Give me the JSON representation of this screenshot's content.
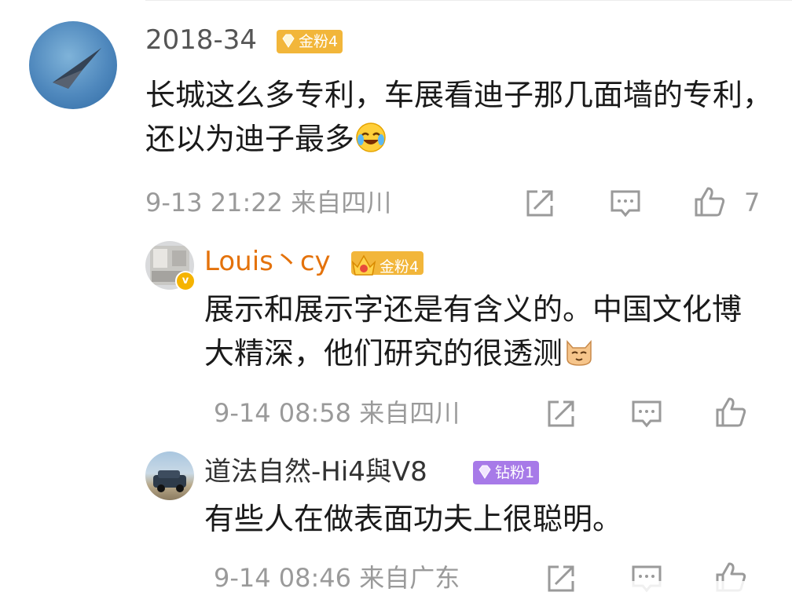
{
  "comment": {
    "username": "2018-34",
    "badge": "金粉4",
    "badge_color": "#f2b63a",
    "text": "长城这么多专利，车展看迪子那几面墙的专利，还以为迪子最多",
    "emoji": "laugh-cry-emoji",
    "meta": "9-13 21:22 来自四川",
    "like_count": "7"
  },
  "replies": [
    {
      "username": "Louis丶cy",
      "username_color": "#e4720b",
      "badge": "金粉4",
      "badge_color": "#f2b63a",
      "verified": "v",
      "text": "展示和展示字还是有含义的。中国文化博大精深，他们研究的很透测",
      "emoji": "cat-emoji",
      "meta": "9-14 08:58 来自四川"
    },
    {
      "username": "道法自然-Hi4與V8",
      "badge": "钻粉1",
      "badge_color": "#a77ae8",
      "text": "有些人在做表面功夫上很聪明。",
      "meta": "9-14 08:46 来自广东"
    }
  ],
  "icons": {
    "repost": "repost-icon",
    "comment": "comment-icon",
    "like": "like-icon"
  }
}
